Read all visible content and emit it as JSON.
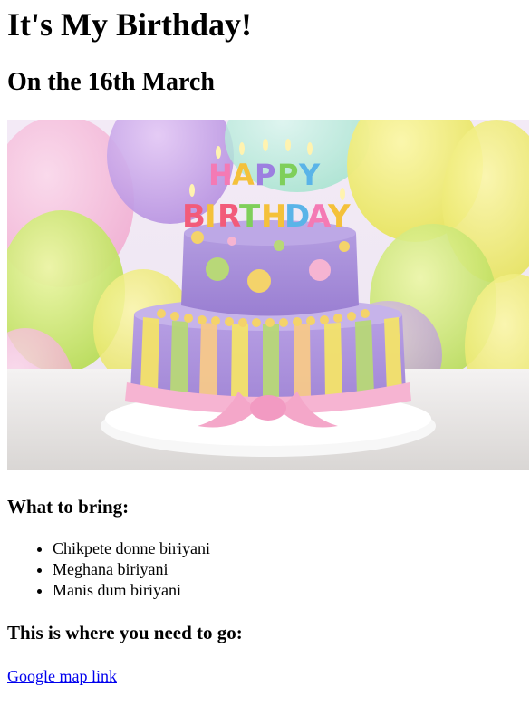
{
  "page": {
    "title": "It's My Birthday!",
    "subtitle": "On the 16th March"
  },
  "image": {
    "icon": "birthday-cake-image",
    "candle_text": "HAPPY BIRTHDAY"
  },
  "bring": {
    "heading": "What to bring:",
    "items": [
      "Chikpete donne biriyani",
      "Meghana biriyani",
      "Manis dum biriyani"
    ]
  },
  "directions": {
    "heading": "This is where you need to go:",
    "link_label": "Google map link"
  },
  "colors": {
    "link": "#0000ee"
  }
}
